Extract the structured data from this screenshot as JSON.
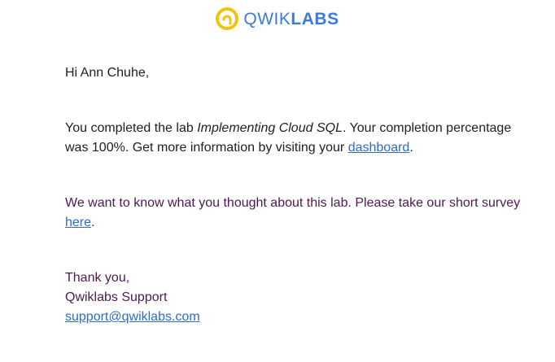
{
  "header": {
    "logo_icon": "qwiklabs-logo-icon",
    "logo_word_light": "QWIK",
    "logo_word_bold": "LABS",
    "brand_blue": "#3b7be0",
    "brand_yellow": "#f4c20d"
  },
  "email": {
    "greeting": "Hi Ann Chuhe,",
    "completed": {
      "prefix": "You completed the lab ",
      "lab_name": "Implementing Cloud SQL",
      "middle": ". Your completion percentage was 100%. Get more information by visiting your ",
      "dashboard_link": "dashboard",
      "suffix": "."
    },
    "survey": {
      "prefix": "We want to know what you thought about this lab. Please take our short survey ",
      "here_link": "here",
      "suffix": "."
    },
    "signoff": {
      "thanks": "Thank you,",
      "team": "Qwiklabs Support",
      "email": "support@qwiklabs.com"
    }
  },
  "colors": {
    "link": "#2a6bd4",
    "purple_text": "#4a1b4f",
    "body_text": "#202124"
  }
}
